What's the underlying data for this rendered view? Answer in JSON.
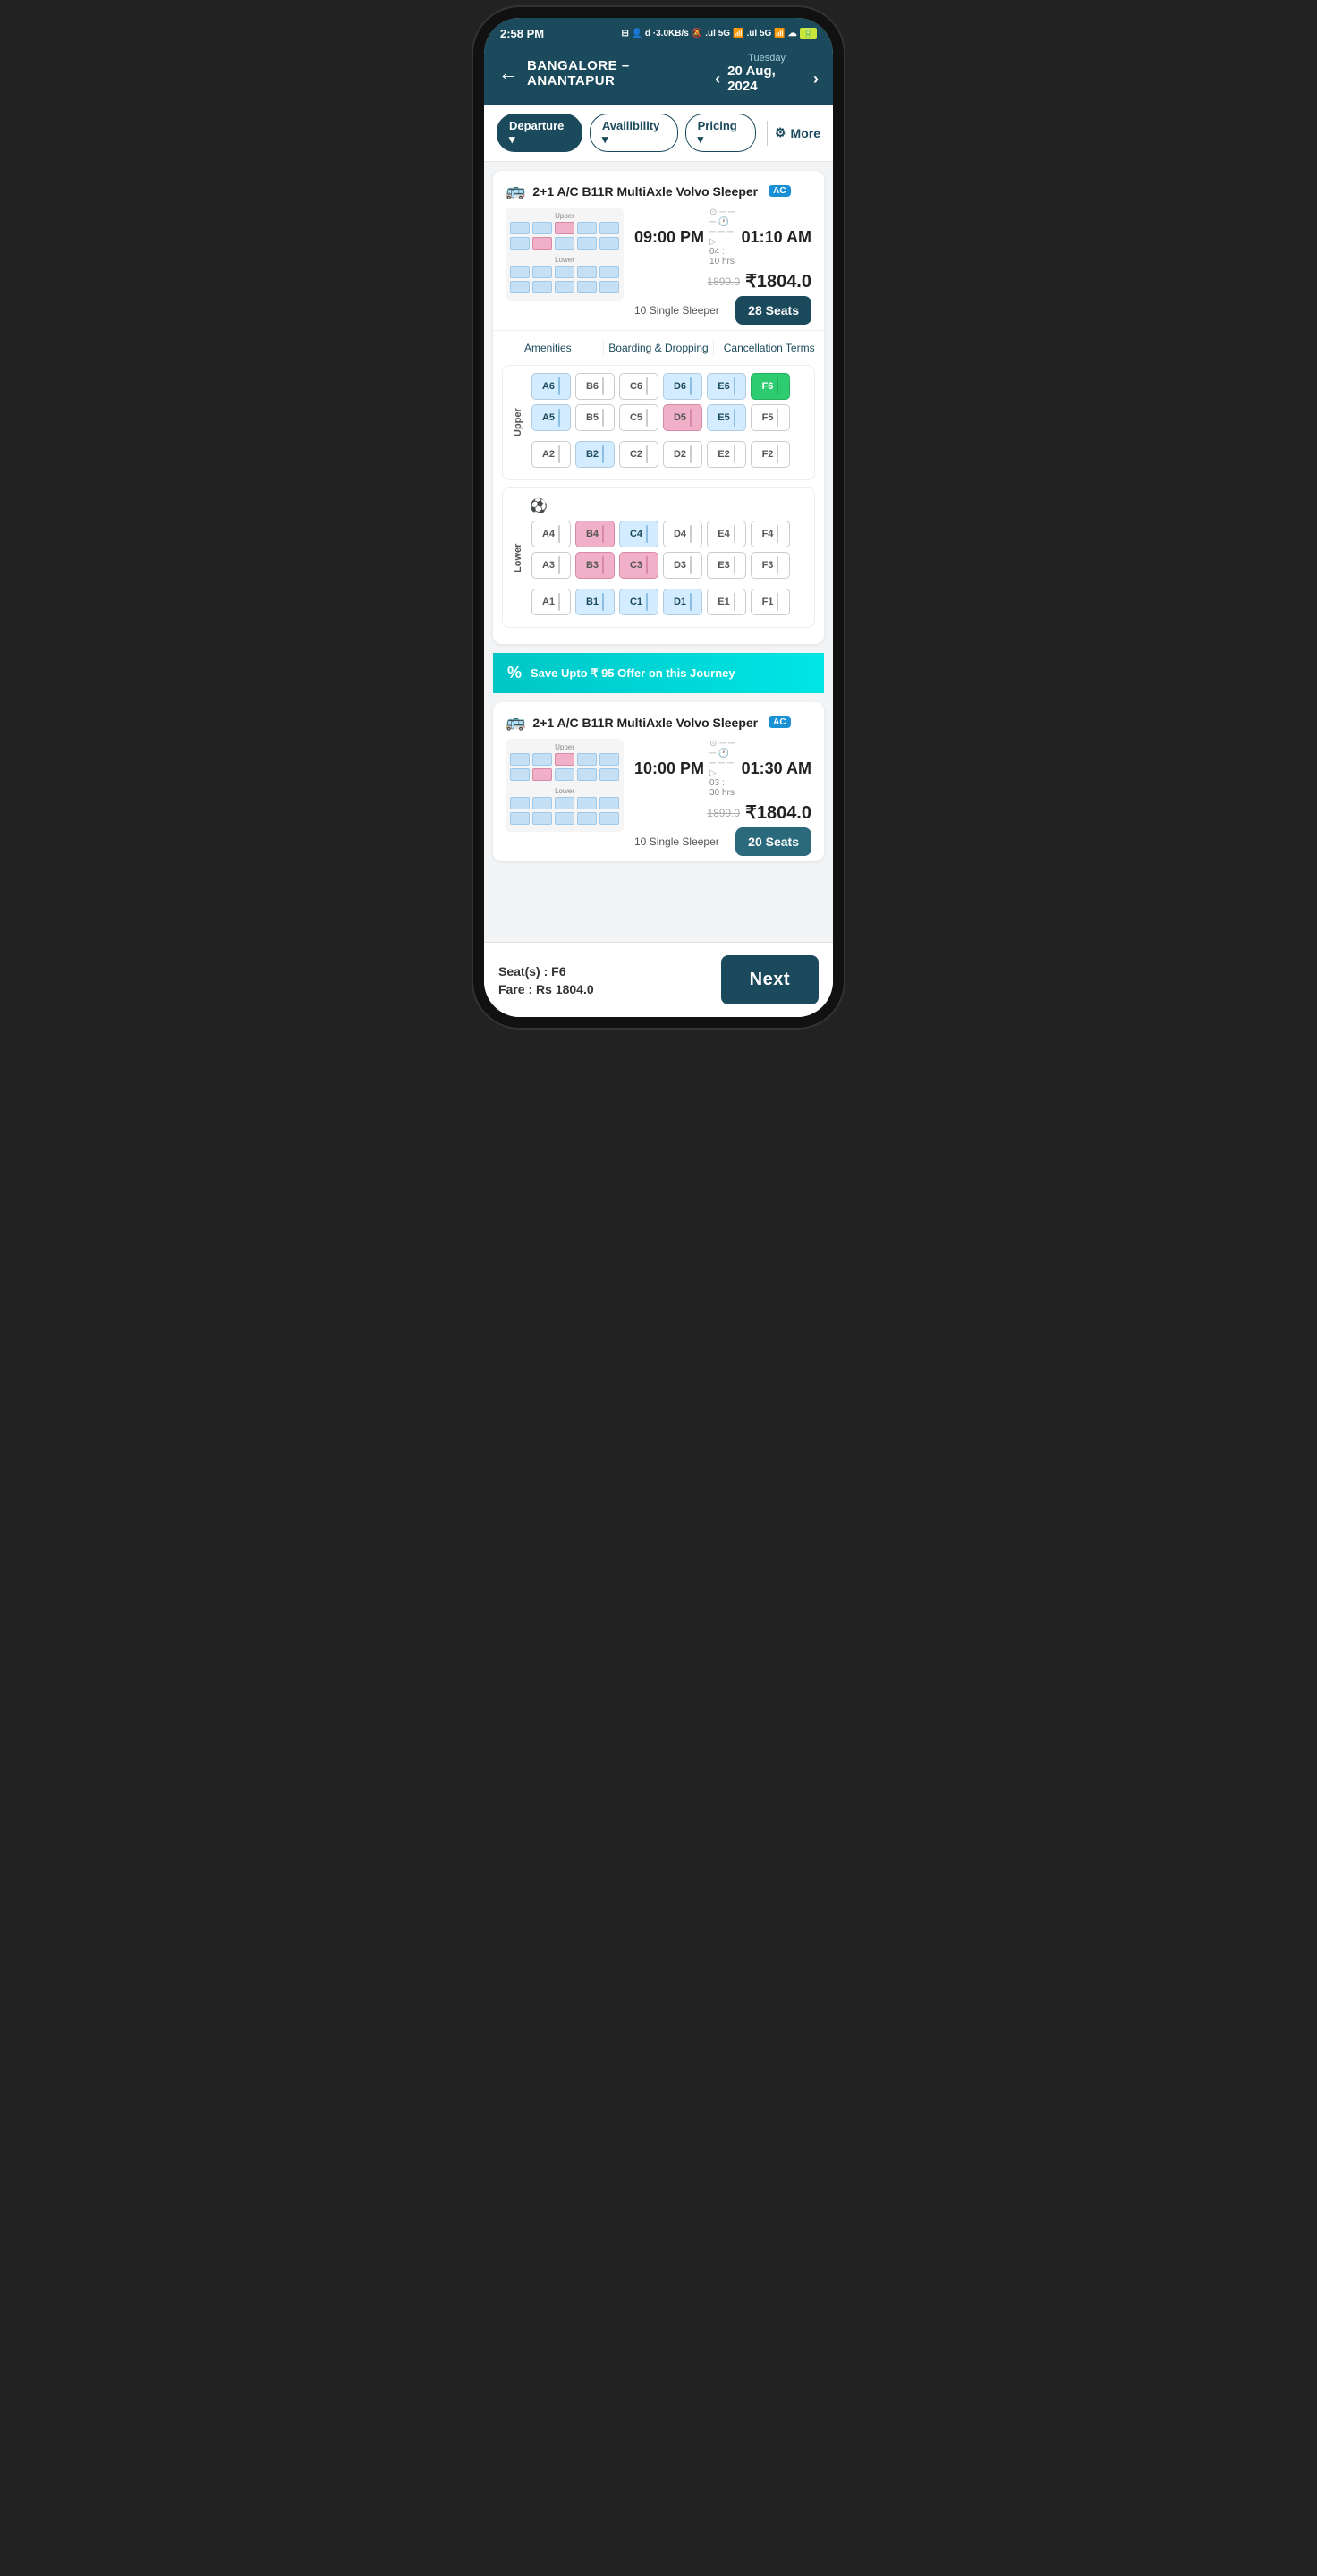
{
  "status_bar": {
    "time": "2:58 PM",
    "icons": "⊟ 👤 d ·3.0KB/s ✗ 🔔 .ul 5G 📶 .ul 5G 📶 ☁ 🔋"
  },
  "header": {
    "back_label": "←",
    "route": "BANGALORE – ANANTAPUR",
    "date_label": "Tuesday",
    "date": "20 Aug, 2024",
    "prev_label": "‹",
    "next_label": "›"
  },
  "filters": {
    "departure_label": "Departure ▾",
    "availability_label": "Availibility ▾",
    "pricing_label": "Pricing ▾",
    "more_label": "More"
  },
  "bus_cards": [
    {
      "id": "bus1",
      "bus_type": "2+1 A/C B11R MultiAxle Volvo Sleeper",
      "ac_badge": "AC",
      "depart_time": "09:00 PM",
      "arrive_time": "01:10 AM",
      "duration": "04 : 10 hrs",
      "original_price": "1899.0",
      "discounted_price": "₹1804.0",
      "seats_label": "28 Seats",
      "single_sleeper_count": "10",
      "single_sleeper_label": "Single Sleeper",
      "amenities": [
        "Amenities",
        "Boarding & Dropping",
        "Cancellation Terms"
      ],
      "upper_seats": [
        [
          "A6",
          "B6",
          "C6",
          "D6",
          "E6",
          "F6"
        ],
        [
          "A5",
          "B5",
          "C5",
          "D5",
          "E5",
          "F5"
        ],
        [
          "A2",
          "B2",
          "C2",
          "D2",
          "E2",
          "F2"
        ]
      ],
      "lower_seats": [
        [
          "A4",
          "B4",
          "C4",
          "D4",
          "E4",
          "F4"
        ],
        [
          "A3",
          "B3",
          "C3",
          "D3",
          "E3",
          "F3"
        ],
        [
          "A1",
          "B1",
          "C1",
          "D1",
          "E1",
          "F1"
        ]
      ]
    },
    {
      "id": "bus2",
      "bus_type": "2+1 A/C B11R MultiAxle Volvo Sleeper",
      "ac_badge": "AC",
      "depart_time": "10:00 PM",
      "arrive_time": "01:30 AM",
      "duration": "03 : 30 hrs",
      "original_price": "1899.0",
      "discounted_price": "₹1804.0",
      "seats_label": "20 Seats",
      "single_sleeper_count": "10",
      "single_sleeper_label": "Single Sleeper"
    }
  ],
  "offer_banner": {
    "icon": "%",
    "text": "Save Upto ₹ 95 Offer on this Journey"
  },
  "bottom_bar": {
    "seat_label": "Seat(s)",
    "seat_value": "F6",
    "fare_label": "Fare",
    "fare_value": "Rs 1804.0",
    "next_button": "Next"
  }
}
